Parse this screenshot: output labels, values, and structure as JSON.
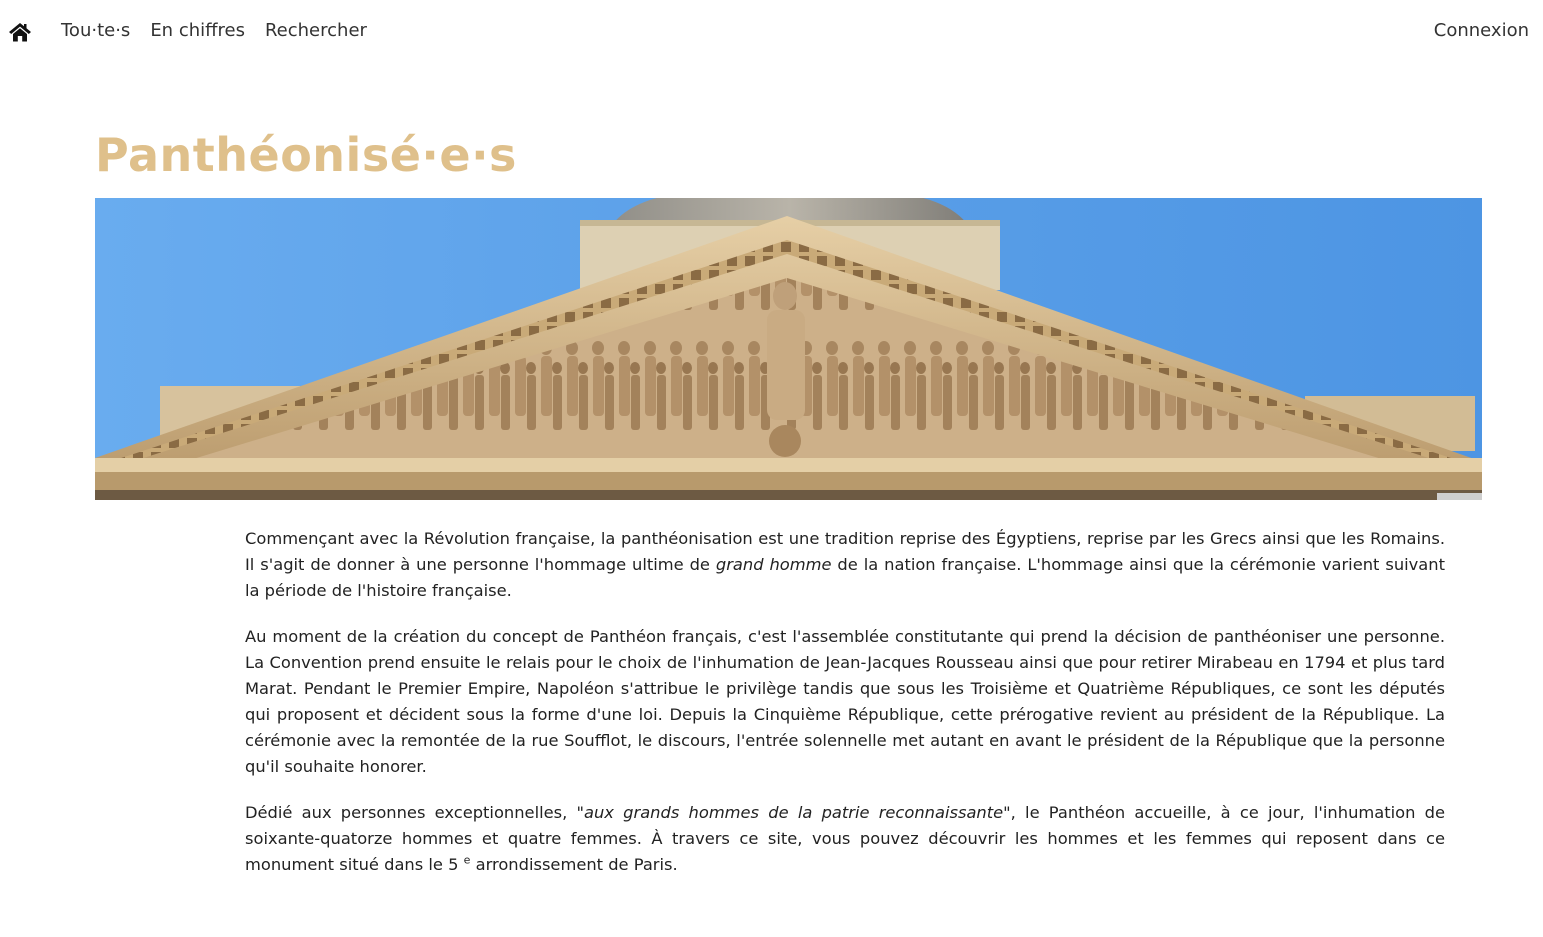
{
  "nav": {
    "home_icon": "home-icon",
    "items": [
      {
        "label": "Tou·te·s"
      },
      {
        "label": "En chiffres"
      },
      {
        "label": "Rechercher"
      }
    ],
    "login_label": "Connexion"
  },
  "page": {
    "title": "Panthéonisé·e·s"
  },
  "hero": {
    "subject": "pediment-of-pantheon-with-dome",
    "sky_color": "#5aa2ea",
    "stone_color": "#d8b98a"
  },
  "content": {
    "p1": {
      "before": "Commençant avec la Révolution française, la panthéonisation est une tradition reprise des Égyptiens, reprise par les Grecs ainsi que les Romains. Il s'agit de donner à une personne l'hommage ultime de ",
      "em": "grand homme",
      "after": " de la nation française. L'hommage ainsi que la cérémonie varient suivant la période de l'histoire française."
    },
    "p2": "Au moment de la création du concept de Panthéon français, c'est l'assemblée constitutante qui prend la décision de panthéoniser une personne. La Convention prend ensuite le relais pour le choix de l'inhumation de Jean-Jacques Rousseau ainsi que pour retirer Mirabeau en 1794 et plus tard Marat. Pendant le Premier Empire, Napoléon s'attribue le privilège tandis que sous les Troisième et Quatrième Républiques, ce sont les députés qui proposent et décident sous la forme d'une loi. Depuis la Cinquième République, cette prérogative revient au président de la République. La cérémonie avec la remontée de la rue Soufflot, le discours, l'entrée solennelle met autant en avant le président de la République que la personne qu'il souhaite honorer.",
    "p3": {
      "before": "Dédié aux personnes exceptionnelles, \"",
      "em": "aux grands hommes de la patrie reconnaissante",
      "middle": "\", le Panthéon accueille, à ce jour, l'inhumation de soixante-quatorze hommes et quatre femmes. À travers ce site, vous pouvez découvrir les hommes et les femmes qui reposent dans ce monument situé dans le 5 ",
      "sup": "e",
      "after": " arrondissement de Paris."
    }
  }
}
